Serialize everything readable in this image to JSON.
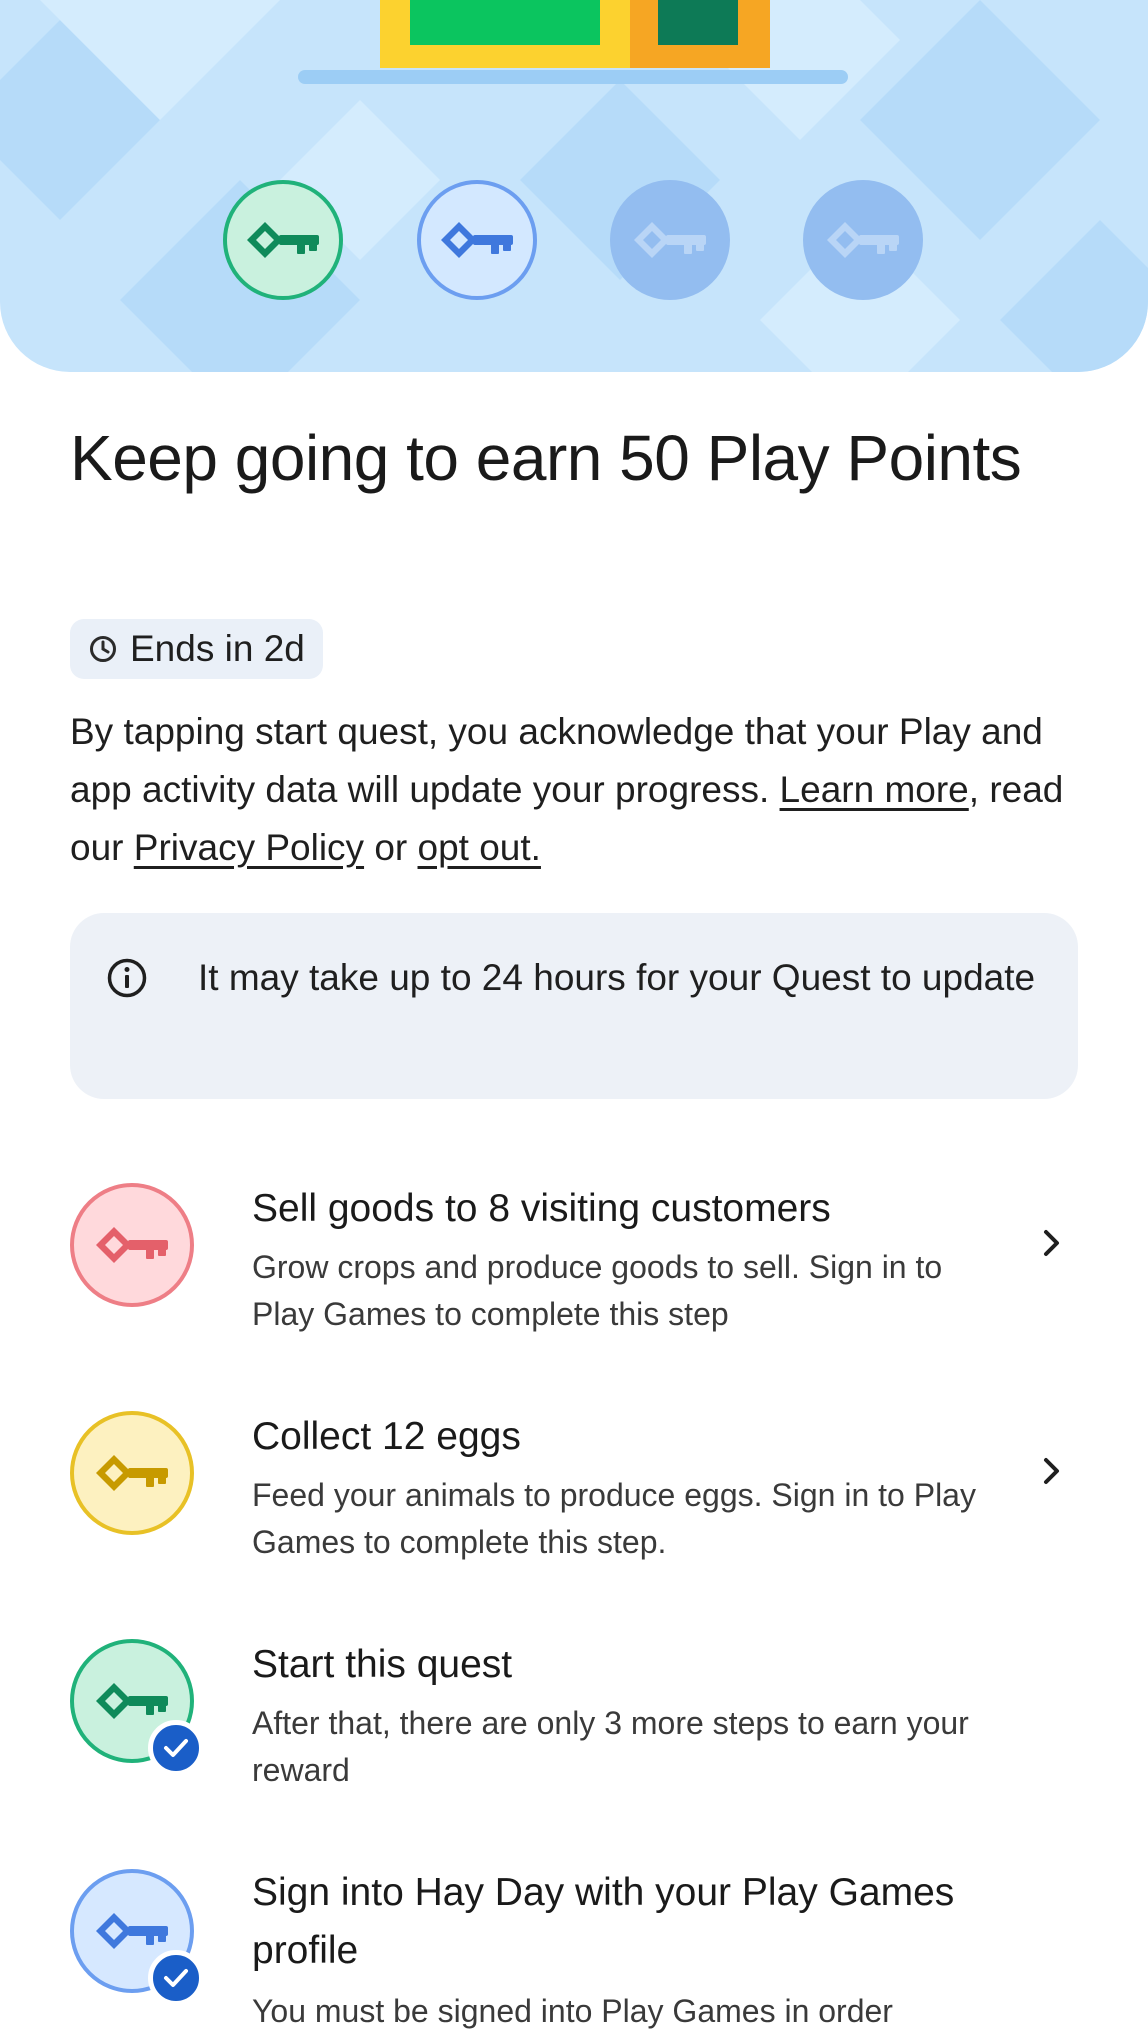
{
  "banner": {
    "keys": [
      {
        "state": "done",
        "color": "#20b27a",
        "icon": "key-icon"
      },
      {
        "state": "done",
        "color": "#6c9ef0",
        "icon": "key-icon"
      },
      {
        "state": "locked",
        "color": "#93bdf0",
        "icon": "key-icon"
      },
      {
        "state": "locked",
        "color": "#93bdf0",
        "icon": "key-icon"
      }
    ]
  },
  "title": "Keep going to earn 50 Play Points",
  "chip": {
    "icon": "clock-icon",
    "label": "Ends in 2d"
  },
  "consent": {
    "text_1": "By tapping start quest, you acknowledge that your Play and app activity data will update your progress.",
    "learn_more": "Learn more",
    "text_2": ", read our ",
    "privacy_policy": "Privacy Policy",
    "text_3": " or ",
    "opt_out": "opt out."
  },
  "info": {
    "icon": "info-icon",
    "text": "It may take up to 24 hours for your Quest to update"
  },
  "steps": [
    {
      "title": "Sell goods to 8 visiting customers",
      "desc": "Grow crops and produce goods to sell. Sign in to Play Games to complete this step",
      "color": "#ee7e86",
      "completed": false
    },
    {
      "title": "Collect 12 eggs",
      "desc": "Feed your animals to produce eggs. Sign in to Play Games to complete this step.",
      "color": "#e8c126",
      "completed": false
    },
    {
      "title": "Start this quest",
      "desc": "After that, there are only 3 more steps to earn your reward",
      "color": "#20b27a",
      "completed": true
    },
    {
      "title": "Sign into Hay Day with your Play Games profile",
      "desc": "You must be signed into Play Games in order",
      "color": "#6c9ef0",
      "completed": true
    }
  ]
}
